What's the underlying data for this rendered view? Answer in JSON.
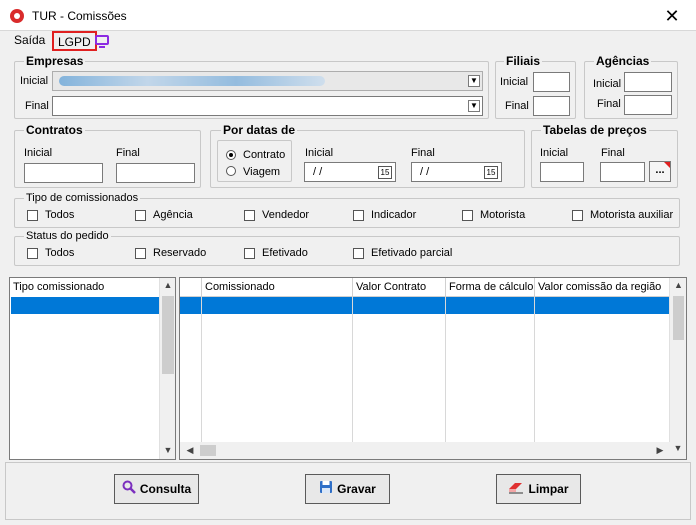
{
  "window": {
    "title": "TUR - Comissões",
    "close_glyph": "✕"
  },
  "menu": {
    "saida": "Saída",
    "lgpd": "LGPD",
    "tv_icon": "monitor-icon"
  },
  "empresas": {
    "title": "Empresas",
    "inicial_label": "Inicial",
    "final_label": "Final",
    "dropdown_glyph": "▼"
  },
  "filiais": {
    "title": "Filiais",
    "inicial_label": "Inicial",
    "final_label": "Final"
  },
  "agencias": {
    "title": "Agências",
    "inicial_label": "Inicial",
    "final_label": "Final"
  },
  "contratos": {
    "title": "Contratos",
    "inicial_label": "Inicial",
    "final_label": "Final"
  },
  "por_datas": {
    "title": "Por datas de",
    "radio_contrato": "Contrato",
    "radio_viagem": "Viagem",
    "inicial_label": "Inicial",
    "final_label": "Final",
    "inicial_value": " / /",
    "final_value": " / /",
    "cal_glyph": "15"
  },
  "tabelas": {
    "title": "Tabelas de preços",
    "inicial_label": "Inicial",
    "final_label": "Final",
    "ellipsis": "..."
  },
  "tipo_comissionados": {
    "title": "Tipo de comissionados",
    "options": [
      "Todos",
      "Agência",
      "Vendedor",
      "Indicador",
      "Motorista",
      "Motorista auxiliar"
    ]
  },
  "status_pedido": {
    "title": "Status do pedido",
    "options": [
      "Todos",
      "Reservado",
      "Efetivado",
      "Efetivado parcial"
    ]
  },
  "left_list": {
    "header": "Tipo comissionado"
  },
  "grid": {
    "columns": [
      "Comissionado",
      "Valor Contrato",
      "Forma de cálculo",
      "Valor comissão da região"
    ]
  },
  "scroll": {
    "up": "▲",
    "down": "▼",
    "left": "◀",
    "right": "▶"
  },
  "buttons": {
    "consulta": "Consulta",
    "gravar": "Gravar",
    "limpar": "Limpar"
  }
}
